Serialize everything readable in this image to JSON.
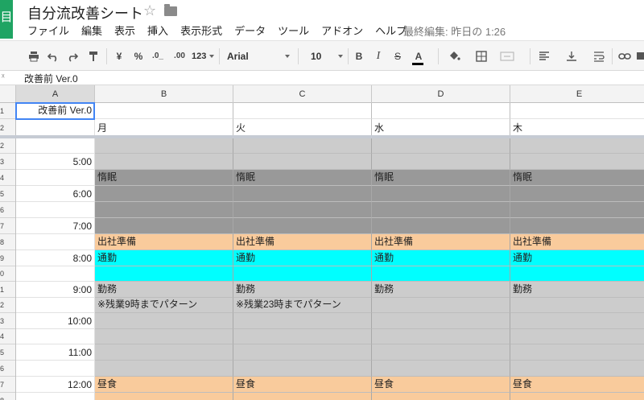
{
  "app": {
    "logo_glyph": "目",
    "doc_title": "自分流改善シート",
    "last_edit": "最終編集: 昨日の 1:26",
    "menu": [
      "ファイル",
      "編集",
      "表示",
      "挿入",
      "表示形式",
      "データ",
      "ツール",
      "アドオン",
      "ヘルプ"
    ]
  },
  "toolbar": {
    "currency": "¥",
    "percent": "%",
    "dec_minus": ".0_",
    "dec_plus": ".00",
    "number_format": "123",
    "font": "Arial",
    "font_size": "10",
    "bold": "B",
    "italic": "I",
    "strike": "S",
    "text_color": "A"
  },
  "formula_bar": {
    "fx": "ˣ",
    "value": "改善前 Ver.0"
  },
  "columns": [
    "A",
    "B",
    "C",
    "D",
    "E"
  ],
  "row_numbers": [
    "1",
    "2",
    "2",
    "3",
    "4",
    "5",
    "6",
    "7",
    "8",
    "9",
    "0",
    "1",
    "2",
    "3",
    "4",
    "5",
    "6",
    "7",
    "8"
  ],
  "colors": {
    "gray_light": "#cccccc",
    "gray_dark": "#999999",
    "orange": "#f9cb9c",
    "cyan": "#00ffff",
    "selection": "#4285f4"
  },
  "rows": [
    {
      "a": "改善前 Ver.0",
      "fill": "",
      "b": "",
      "c": "",
      "d": "",
      "e": ""
    },
    {
      "a": "",
      "fill": "",
      "b": "月",
      "c": "火",
      "d": "水",
      "e": "木"
    },
    {
      "a": "",
      "fill": "gray_light",
      "b": "",
      "c": "",
      "d": "",
      "e": ""
    },
    {
      "a": "5:00",
      "fill": "gray_light",
      "b": "",
      "c": "",
      "d": "",
      "e": ""
    },
    {
      "a": "",
      "fill": "gray_dark",
      "b": "惰眠",
      "c": "惰眠",
      "d": "惰眠",
      "e": "惰眠"
    },
    {
      "a": "6:00",
      "fill": "gray_dark",
      "b": "",
      "c": "",
      "d": "",
      "e": ""
    },
    {
      "a": "",
      "fill": "gray_dark",
      "b": "",
      "c": "",
      "d": "",
      "e": ""
    },
    {
      "a": "7:00",
      "fill": "gray_dark",
      "b": "",
      "c": "",
      "d": "",
      "e": ""
    },
    {
      "a": "",
      "fill": "orange",
      "b": "出社準備",
      "c": "出社準備",
      "d": "出社準備",
      "e": "出社準備"
    },
    {
      "a": "8:00",
      "fill": "cyan",
      "b": "通勤",
      "c": "通勤",
      "d": "通勤",
      "e": "通勤"
    },
    {
      "a": "",
      "fill": "cyan",
      "b": "",
      "c": "",
      "d": "",
      "e": ""
    },
    {
      "a": "9:00",
      "fill": "gray_light",
      "b": "勤務",
      "c": "勤務",
      "d": "勤務",
      "e": "勤務"
    },
    {
      "a": "",
      "fill": "gray_light",
      "b": "※残業9時までパターン",
      "c": "※残業23時までパターン",
      "d": "",
      "e": ""
    },
    {
      "a": "10:00",
      "fill": "gray_light",
      "b": "",
      "c": "",
      "d": "",
      "e": ""
    },
    {
      "a": "",
      "fill": "gray_light",
      "b": "",
      "c": "",
      "d": "",
      "e": ""
    },
    {
      "a": "11:00",
      "fill": "gray_light",
      "b": "",
      "c": "",
      "d": "",
      "e": ""
    },
    {
      "a": "",
      "fill": "gray_light",
      "b": "",
      "c": "",
      "d": "",
      "e": ""
    },
    {
      "a": "12:00",
      "fill": "orange",
      "b": "昼食",
      "c": "昼食",
      "d": "昼食",
      "e": "昼食"
    },
    {
      "a": "",
      "fill": "orange",
      "b": "",
      "c": "",
      "d": "",
      "e": ""
    }
  ]
}
